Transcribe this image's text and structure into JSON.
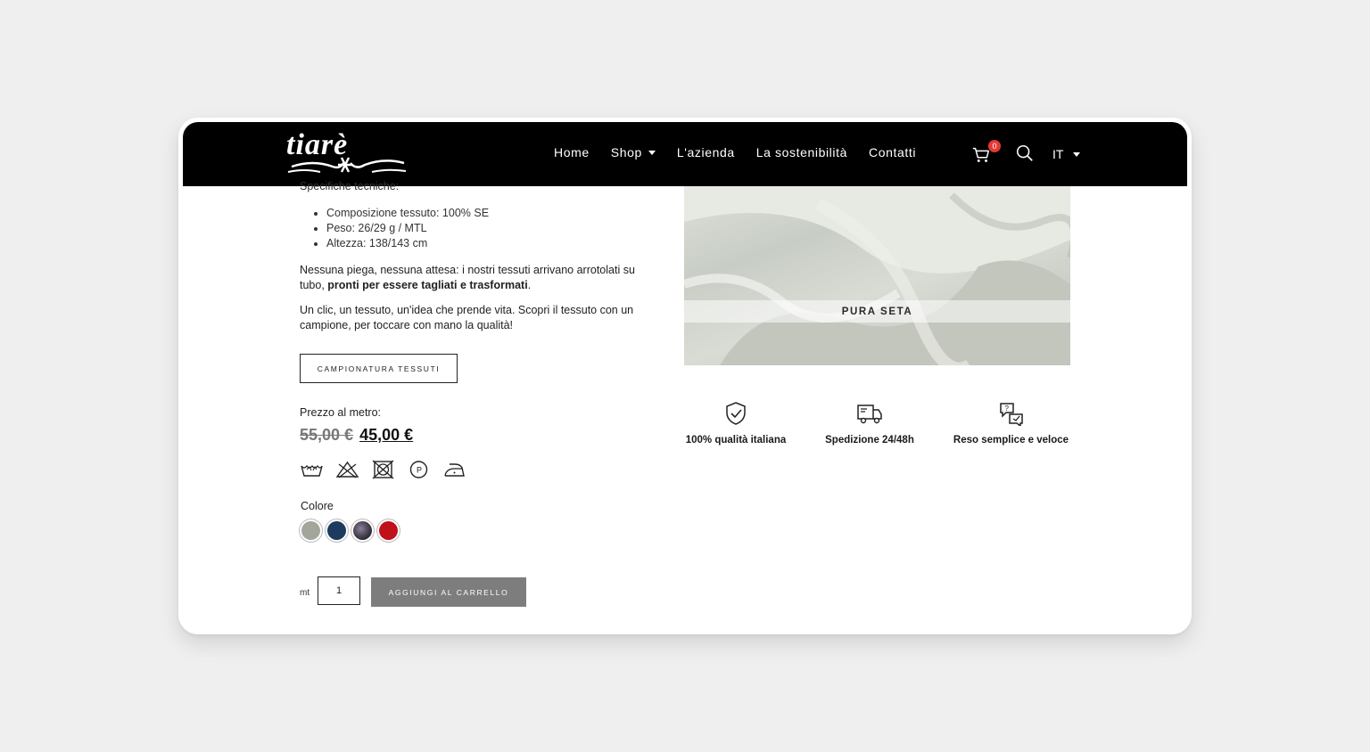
{
  "brand": {
    "logo_text": "tiarè"
  },
  "nav": {
    "items": [
      {
        "label": "Home",
        "dropdown": false
      },
      {
        "label": "Shop",
        "dropdown": true
      },
      {
        "label": "L'azienda",
        "dropdown": false
      },
      {
        "label": "La sostenibilità",
        "dropdown": false
      },
      {
        "label": "Contatti",
        "dropdown": false
      }
    ],
    "cart_count": "0",
    "language": "IT"
  },
  "product": {
    "spec_heading": "Specifiche tecniche:",
    "specs": [
      "Composizione tessuto: 100% SE",
      "Peso: 26/29 g / MTL",
      "Altezza: 138/143 cm"
    ],
    "para1_text": "Nessuna piega, nessuna attesa: i nostri tessuti arrivano arrotolati su tubo,",
    "para1_bold": "pronti per essere tagliati e trasformati",
    "para1_end": ".",
    "para2": "Un clic, un tessuto, un'idea che prende vita. Scopri il tessuto con un campione, per toccare con mano la qualità!",
    "sample_button": "CAMPIONATURA TESSUTI",
    "price_label": "Prezzo al metro:",
    "price_old": "55,00 €",
    "price_new": "45,00 €",
    "care_icons": [
      "hand-wash-icon",
      "no-bleach-icon",
      "no-tumble-dry-icon",
      "dry-clean-p-icon",
      "iron-low-icon"
    ],
    "color_label": "Colore",
    "colors": [
      {
        "name": "grigio-verde",
        "hex": "#a3a79b"
      },
      {
        "name": "blu",
        "hex": "#1c3b5e"
      },
      {
        "name": "fantasia-scura",
        "hex": "#3b3442"
      },
      {
        "name": "rosso",
        "hex": "#c0101b"
      }
    ],
    "qty_label": "mt",
    "qty_value": "1",
    "add_to_cart": "AGGIUNGI AL CARRELLO"
  },
  "hero": {
    "caption": "PURA SETA"
  },
  "features": [
    {
      "icon": "shield-check-icon",
      "label": "100% qualità italiana"
    },
    {
      "icon": "delivery-truck-icon",
      "label": "Spedizione 24/48h"
    },
    {
      "icon": "return-chat-icon",
      "label": "Reso semplice e veloce"
    }
  ],
  "colors": {
    "header_bg": "#000000",
    "badge": "#e53935",
    "add_button_bg": "#7d7d7d"
  }
}
